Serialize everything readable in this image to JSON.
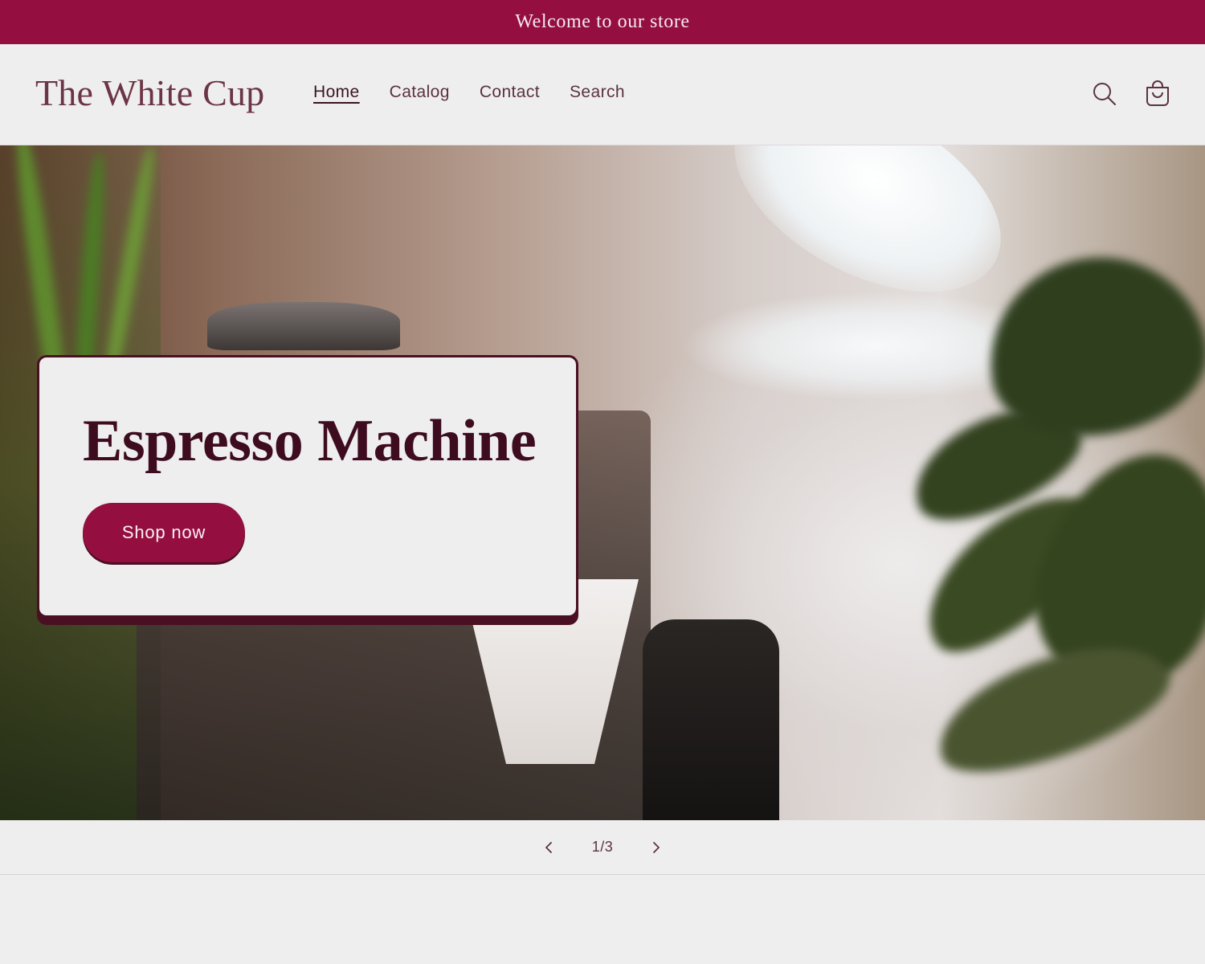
{
  "announcement": {
    "text": "Welcome to our store"
  },
  "header": {
    "logo": "The White Cup",
    "nav": [
      {
        "label": "Home",
        "active": true
      },
      {
        "label": "Catalog",
        "active": false
      },
      {
        "label": "Contact",
        "active": false
      },
      {
        "label": "Search",
        "active": false
      }
    ],
    "icons": {
      "search": "search-icon",
      "cart": "cart-icon"
    }
  },
  "hero": {
    "title": "Espresso Machine",
    "button_label": "Shop now",
    "image": "espresso-machine-counter-photo"
  },
  "slider": {
    "counter": "1/3"
  },
  "colors": {
    "brand": "#940f40",
    "dark": "#4a0f22",
    "background": "#efeeee",
    "text": "#5a3242"
  }
}
